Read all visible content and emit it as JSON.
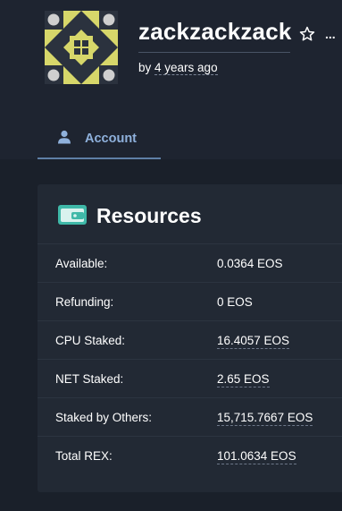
{
  "profile": {
    "username": "zackzackzack",
    "created_prefix": "by",
    "created_ago": "4 years ago",
    "favorite_icon": "star-outline-icon",
    "more_label": "..."
  },
  "tabs": [
    {
      "label": "Account",
      "icon": "user-icon",
      "active": true
    }
  ],
  "resources": {
    "title": "Resources",
    "icon": "wallet-icon",
    "rows": [
      {
        "label": "Available:",
        "value": "0.0364 EOS"
      },
      {
        "label": "Refunding:",
        "value": "0 EOS"
      },
      {
        "label": "CPU Staked:",
        "value": "16.4057 EOS"
      },
      {
        "label": "NET Staked:",
        "value": "2.65 EOS"
      },
      {
        "label": "Staked by Others:",
        "value": "15,715.7667 EOS"
      },
      {
        "label": "Total REX:",
        "value": "101.0634 EOS"
      }
    ]
  },
  "colors": {
    "background": "#1a202a",
    "header_band": "#1e2430",
    "card": "#222934",
    "accent_tab": "#8fb1dc",
    "avatar_yellow": "#d7d76a",
    "avatar_grey": "#cfcfcf",
    "wallet_teal": "#3fb8a8"
  }
}
